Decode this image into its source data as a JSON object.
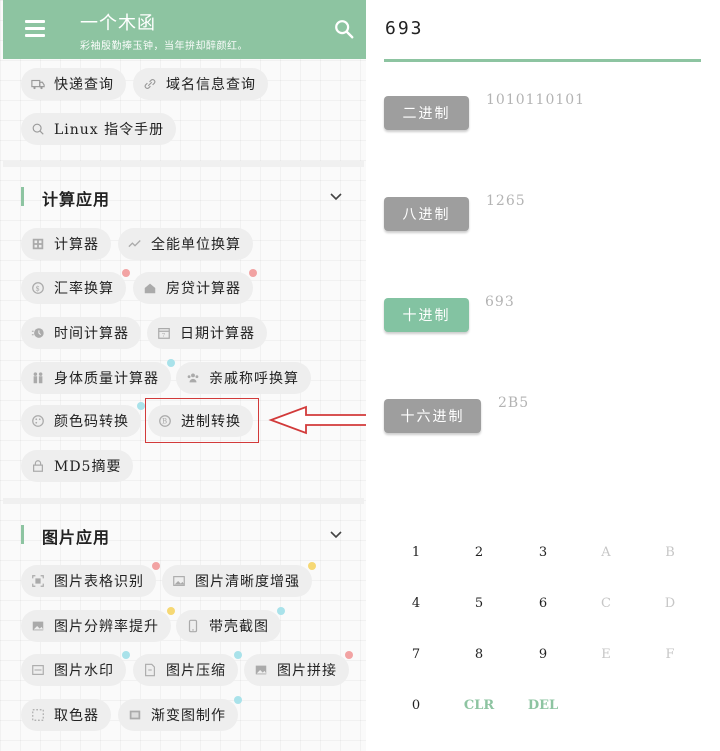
{
  "header": {
    "title": "一个木函",
    "subtitle": "彩袖殷勤捧玉钟，当年拚却醉颜红。"
  },
  "top_chips": [
    {
      "label": "快递查询"
    },
    {
      "label": "域名信息查询"
    },
    {
      "label": "Linux 指令手册"
    }
  ],
  "sections": {
    "calc": {
      "title": "计算应用",
      "items": [
        {
          "label": "计算器"
        },
        {
          "label": "全能单位换算"
        },
        {
          "label": "汇率换算"
        },
        {
          "label": "房贷计算器"
        },
        {
          "label": "时间计算器"
        },
        {
          "label": "日期计算器"
        },
        {
          "label": "身体质量计算器"
        },
        {
          "label": "亲戚称呼换算"
        },
        {
          "label": "颜色码转换"
        },
        {
          "label": "进制转换"
        },
        {
          "label": "MD5摘要"
        }
      ]
    },
    "image": {
      "title": "图片应用",
      "items": [
        {
          "label": "图片表格识别"
        },
        {
          "label": "图片清晰度增强"
        },
        {
          "label": "图片分辨率提升"
        },
        {
          "label": "带壳截图"
        },
        {
          "label": "图片水印"
        },
        {
          "label": "图片压缩"
        },
        {
          "label": "图片拼接"
        },
        {
          "label": "取色器"
        },
        {
          "label": "渐变图制作"
        }
      ]
    }
  },
  "converter": {
    "input_value": "693",
    "bases": [
      {
        "label": "二进制",
        "value": "1010110101",
        "active": false
      },
      {
        "label": "八进制",
        "value": "1265",
        "active": false
      },
      {
        "label": "十进制",
        "value": "693",
        "active": true
      },
      {
        "label": "十六进制",
        "value": "2B5",
        "active": false
      }
    ],
    "keypad": [
      [
        "1",
        "2",
        "3",
        "A",
        "B"
      ],
      [
        "4",
        "5",
        "6",
        "C",
        "D"
      ],
      [
        "7",
        "8",
        "9",
        "E",
        "F"
      ],
      [
        "0",
        "CLR",
        "DEL"
      ]
    ]
  },
  "colors": {
    "accent": "#8dc4a1",
    "inactive_button": "#9e9e9e",
    "highlight": "#d23a3a"
  }
}
